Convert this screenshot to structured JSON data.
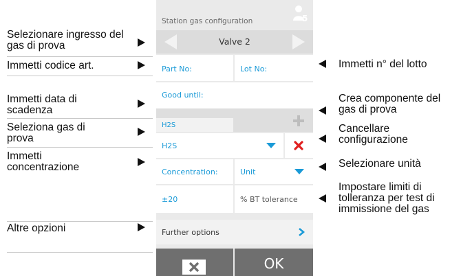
{
  "annotations": {
    "left": {
      "select_inlet": "Selezionare ingresso del gas di prova",
      "enter_part_no": "Immetti codice art.",
      "enter_expiry": "Immetti data di scadenza",
      "select_gas": "Seleziona gas di prova",
      "enter_concentration": "Immetti concentrazione",
      "more_options": "Altre opzioni"
    },
    "right": {
      "enter_lot": "Immetti n° del lotto",
      "create_component": "Crea componente del gas di prova",
      "delete_config": "Cancellare configurazione",
      "select_unit": "Selezionare unità",
      "set_limits": "Impostare limiti di tolleranza per test di immissione del gas"
    }
  },
  "screen": {
    "title": "Station gas configuration",
    "user_badge": "5",
    "valve": {
      "value": "Valve 2"
    },
    "part_no_placeholder": "Part No:",
    "lot_no_placeholder": "Lot No:",
    "good_until_placeholder": "Good until:",
    "gas_tab": "H2S",
    "gas_select": {
      "value": "H2S"
    },
    "concentration_label": "Concentration:",
    "unit_select": {
      "value": "Unit"
    },
    "tolerance_value": "±20",
    "tolerance_label": "% BT tolerance",
    "further_options": "Further options",
    "cancel_icon": "close-x-icon",
    "ok_label": "OK"
  },
  "colors": {
    "accent_blue": "#1a9ad7",
    "delete_red": "#e02020",
    "bottom_bar": "#6f6f6f"
  }
}
